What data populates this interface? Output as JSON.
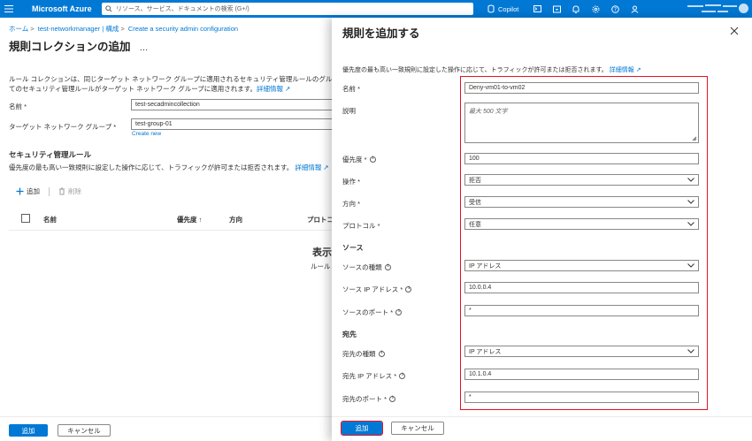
{
  "topbar": {
    "brand": "Microsoft Azure",
    "search_placeholder": "リソース、サービス、ドキュメントの検索 (G+/)",
    "copilot": "Copilot",
    "account_line1": "",
    "account_line2": ""
  },
  "left": {
    "breadcrumb": [
      "ホーム",
      "test-networkmanager | 構成",
      "Create a security admin configuration"
    ],
    "title": "規則コレクションの追加",
    "more": "…",
    "desc_line1": "ルール コレクションは、同じターゲット ネットワーク グループに適用されるセキュリティ管理ルールのグループ",
    "desc_line2": "てのセキュリティ管理ルールがターゲット ネットワーク グループに適用されます。",
    "desc_link": "詳細情報",
    "name_label": "名前 *",
    "name_value": "test-secadmincollection",
    "target_label": "ターゲット ネットワーク グループ *",
    "target_value": "test-group-01",
    "create_new": "Create new",
    "section_title": "セキュリティ管理ルール",
    "section_desc": "優先度の最も高い一致規則に設定した操作に応じて、トラフィックが許可または拒否されます。",
    "section_link": "詳細情報",
    "toolbar_add": "追加",
    "toolbar_delete": "削除",
    "col_name": "名前",
    "col_priority": "優先度 ↑",
    "col_direction": "方向",
    "col_protocol": "プロトコ",
    "empty_title": "表示",
    "empty_sub": "ルール",
    "btn_add": "追加",
    "btn_cancel": "キャンセル"
  },
  "panel": {
    "title": "規則を追加する",
    "desc": "優先度の最も高い一致規則に設定した操作に応じて、トラフィックが許可または拒否されます。",
    "desc_link": "詳細情報",
    "fields": {
      "name_label": "名前 *",
      "name_value": "Deny-vm01-to-vm02",
      "desc_label": "説明",
      "desc_placeholder": "最大 500 文字",
      "priority_label": "優先度 *",
      "priority_value": "100",
      "action_label": "操作 *",
      "action_value": "拒否",
      "direction_label": "方向 *",
      "direction_value": "受信",
      "protocol_label": "プロトコル *",
      "protocol_value": "任意"
    },
    "source": {
      "heading": "ソース",
      "type_label": "ソースの種類",
      "type_value": "IP アドレス",
      "ip_label": "ソース IP アドレス *",
      "ip_value": "10.0.0.4",
      "port_label": "ソースのポート *",
      "port_value": "*"
    },
    "dest": {
      "heading": "宛先",
      "type_label": "宛先の種類",
      "type_value": "IP アドレス",
      "ip_label": "宛先 IP アドレス *",
      "ip_value": "10.1.0.4",
      "port_label": "宛先のポート *",
      "port_value": "*"
    },
    "btn_add": "追加",
    "btn_cancel": "キャンセル"
  }
}
